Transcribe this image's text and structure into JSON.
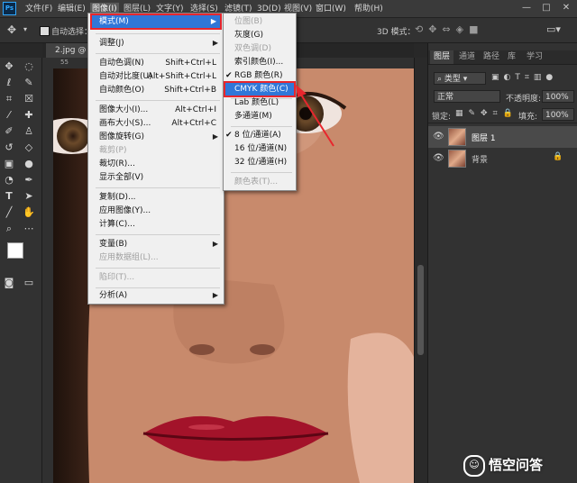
{
  "menubar": {
    "items": [
      "文件(F)",
      "编辑(E)",
      "图像(I)",
      "图层(L)",
      "文字(Y)",
      "选择(S)",
      "滤镜(T)",
      "3D(D)",
      "视图(V)",
      "窗口(W)",
      "帮助(H)"
    ],
    "window_controls": [
      "—",
      "□",
      "✕"
    ]
  },
  "options_bar": {
    "auto_select": "自动选择：",
    "mode3d": "3D 模式："
  },
  "document": {
    "tab_title": "2.jpg @ 48.",
    "ruler_marks": [
      "55",
      "50"
    ]
  },
  "image_menu": {
    "items": [
      {
        "label": "模式(M)",
        "shortcut": "",
        "submenu": true,
        "state": "selected"
      },
      {
        "label": "调整(J)",
        "shortcut": "",
        "submenu": true
      },
      {
        "label": "自动色调(N)",
        "shortcut": "Shift+Ctrl+L"
      },
      {
        "label": "自动对比度(U)",
        "shortcut": "Alt+Shift+Ctrl+L"
      },
      {
        "label": "自动颜色(O)",
        "shortcut": "Shift+Ctrl+B"
      },
      {
        "label": "图像大小(I)...",
        "shortcut": "Alt+Ctrl+I"
      },
      {
        "label": "画布大小(S)...",
        "shortcut": "Alt+Ctrl+C"
      },
      {
        "label": "图像旋转(G)",
        "shortcut": "",
        "submenu": true
      },
      {
        "label": "裁剪(P)",
        "shortcut": "",
        "disabled": true
      },
      {
        "label": "裁切(R)...",
        "shortcut": ""
      },
      {
        "label": "显示全部(V)",
        "shortcut": ""
      },
      {
        "label": "复制(D)...",
        "shortcut": ""
      },
      {
        "label": "应用图像(Y)...",
        "shortcut": ""
      },
      {
        "label": "计算(C)...",
        "shortcut": ""
      },
      {
        "label": "变量(B)",
        "shortcut": "",
        "submenu": true
      },
      {
        "label": "应用数据组(L)...",
        "shortcut": "",
        "disabled": true
      },
      {
        "label": "陷印(T)...",
        "shortcut": "",
        "disabled": true
      },
      {
        "label": "分析(A)",
        "shortcut": "",
        "submenu": true
      }
    ]
  },
  "mode_submenu": {
    "items": [
      {
        "label": "位图(B)",
        "disabled": true
      },
      {
        "label": "灰度(G)"
      },
      {
        "label": "双色调(D)",
        "disabled": true
      },
      {
        "label": "索引颜色(I)..."
      },
      {
        "label": "RGB 颜色(R)",
        "checked": true
      },
      {
        "label": "CMYK 颜色(C)",
        "state": "highlighted"
      },
      {
        "label": "Lab 颜色(L)"
      },
      {
        "label": "多通道(M)"
      },
      {
        "label": "8 位/通道(A)",
        "checked": true
      },
      {
        "label": "16 位/通道(N)"
      },
      {
        "label": "32 位/通道(H)"
      },
      {
        "label": "颜色表(T)...",
        "disabled": true
      }
    ]
  },
  "layers_panel": {
    "tabs": [
      "图层",
      "通道",
      "路径",
      "库",
      "学习"
    ],
    "filter_kind": "类型",
    "blend_mode": "正常",
    "opacity_label": "不透明度:",
    "opacity_value": "100%",
    "lock_label": "锁定:",
    "fill_label": "填充:",
    "fill_value": "100%",
    "layers": [
      {
        "name": "图层 1",
        "selected": true
      },
      {
        "name": "背景",
        "locked": true
      }
    ]
  },
  "watermark": "悟空问答",
  "colors": {
    "accent": "#3077d8",
    "annotation": "#e8262d",
    "lips": "#a3132a"
  }
}
